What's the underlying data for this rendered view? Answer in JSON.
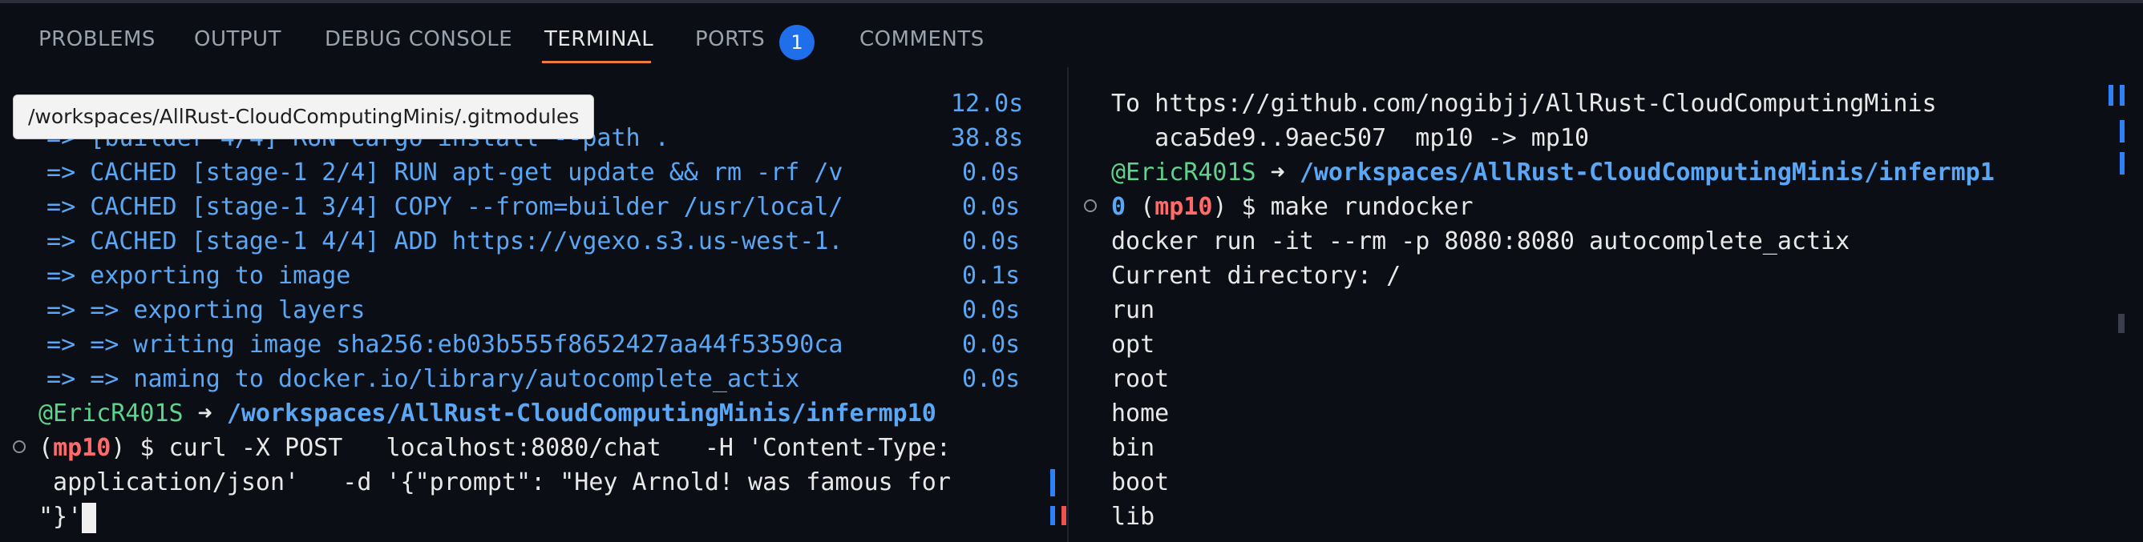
{
  "panel_tabs": [
    {
      "label": "PROBLEMS"
    },
    {
      "label": "OUTPUT"
    },
    {
      "label": "DEBUG CONSOLE"
    },
    {
      "label": "TERMINAL"
    },
    {
      "label": "PORTS"
    },
    {
      "label": "COMMENTS"
    }
  ],
  "active_tab": "TERMINAL",
  "ports_badge": "1",
  "tooltip": "/workspaces/AllRust-CloudComputingMinis/.gitmodules",
  "left_terminal": {
    "build_lines": [
      {
        "text": "                                                        ",
        "time": "12.0s"
      },
      {
        "text": " => [builder 4/4] RUN cargo install --path .",
        "time": "38.8s"
      },
      {
        "text": " => CACHED [stage-1 2/4] RUN apt-get update && rm -rf /v",
        "time": "0.0s"
      },
      {
        "text": " => CACHED [stage-1 3/4] COPY --from=builder /usr/local/",
        "time": "0.0s"
      },
      {
        "text": " => CACHED [stage-1 4/4] ADD https://vgexo.s3.us-west-1.",
        "time": "0.0s"
      },
      {
        "text": " => exporting to image",
        "time": "0.1s"
      },
      {
        "text": " => => exporting layers",
        "time": "0.0s"
      },
      {
        "text": " => => writing image sha256:eb03b555f8652427aa44f53590ca",
        "time": "0.0s"
      },
      {
        "text": " => => naming to docker.io/library/autocomplete_actix",
        "time": "0.0s"
      }
    ],
    "prompt_user": "@EricR401S",
    "prompt_arrow": " ➜ ",
    "prompt_path": "/workspaces/AllRust-CloudComputingMinis/infermp10",
    "branch_open": "(",
    "branch": "mp10",
    "branch_close": ")",
    "command_line1": " $ curl -X POST   localhost:8080/chat   -H 'Content-Type:",
    "command_line2": " application/json'   -d '{\"prompt\": \"Hey Arnold! was famous for",
    "command_line3": "\"}'"
  },
  "right_terminal": {
    "push_line1": "To https://github.com/nogibjj/AllRust-CloudComputingMinis",
    "push_line2": "   aca5de9..9aec507  mp10 -> mp10",
    "prompt_user": "@EricR401S",
    "prompt_arrow": " ➜ ",
    "prompt_path_line1": "/workspaces/AllRust-CloudComputingMinis/infermp1",
    "prompt_path_line2": "0",
    "branch_open": " (",
    "branch": "mp10",
    "branch_close": ")",
    "command": " $ make rundocker",
    "output": [
      "docker run -it --rm -p 8080:8080 autocomplete_actix",
      "Current directory: /",
      "run",
      "opt",
      "root",
      "home",
      "bin",
      "boot",
      "lib"
    ]
  },
  "colors": {
    "background": "#0b0e14",
    "accent_tab": "#f07b3f",
    "badge": "#1f6feb",
    "build_text": "#5aa7f5",
    "prompt_user": "#5fd38d",
    "branch": "#ff6b6b"
  }
}
